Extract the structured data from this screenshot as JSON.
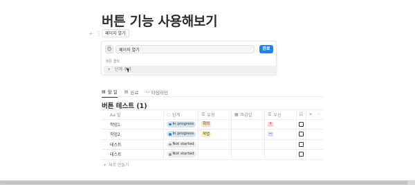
{
  "page": {
    "title": "버튼 기능 사용해보기"
  },
  "button_block": {
    "label": "페이지 열기"
  },
  "button_editor": {
    "icon": "😊",
    "name_value": "페이지 열기",
    "done_label": "완료",
    "actions_label": "버튼 클릭",
    "add_step_label": "단계 추가"
  },
  "views": [
    {
      "label": "할 일",
      "icon": "table-icon",
      "active": true
    },
    {
      "label": "완료",
      "icon": "table-icon",
      "active": false
    },
    {
      "label": "타임라인",
      "icon": "timeline-icon",
      "active": false
    }
  ],
  "database": {
    "title": "버튼 테스트 (1)",
    "columns": {
      "name": "Aa 일",
      "status": "단계",
      "type": "유형",
      "due": "마감일",
      "priority": "우선"
    },
    "rows": [
      {
        "name": "작업1",
        "status": "In progress",
        "status_color": "#2f80ed",
        "type": "회의",
        "type_bg": "#fde2c9",
        "priority_mark": "↑",
        "priority_bg": "#fdd0d0",
        "checked": false
      },
      {
        "name": "작업2",
        "status": "In progress",
        "status_color": "#2f80ed",
        "type": "작업",
        "type_bg": "#fbeeb8",
        "priority_mark": "—",
        "priority_bg": "#e6dcf5",
        "checked": false
      },
      {
        "name": "테스트",
        "status": "Not started",
        "status_color": "#9b9a97",
        "type": "",
        "type_bg": "",
        "priority_mark": "",
        "priority_bg": "",
        "checked": false
      },
      {
        "name": "테스트",
        "status": "Not started",
        "status_color": "#9b9a97",
        "type": "",
        "type_bg": "",
        "priority_mark": "",
        "priority_bg": "",
        "checked": false
      }
    ],
    "new_row_label": "새로 만들기"
  },
  "colors": {
    "accent": "#2383e2",
    "in_progress_bg": "#d3e5ef",
    "not_started_bg": "#ececeb"
  }
}
